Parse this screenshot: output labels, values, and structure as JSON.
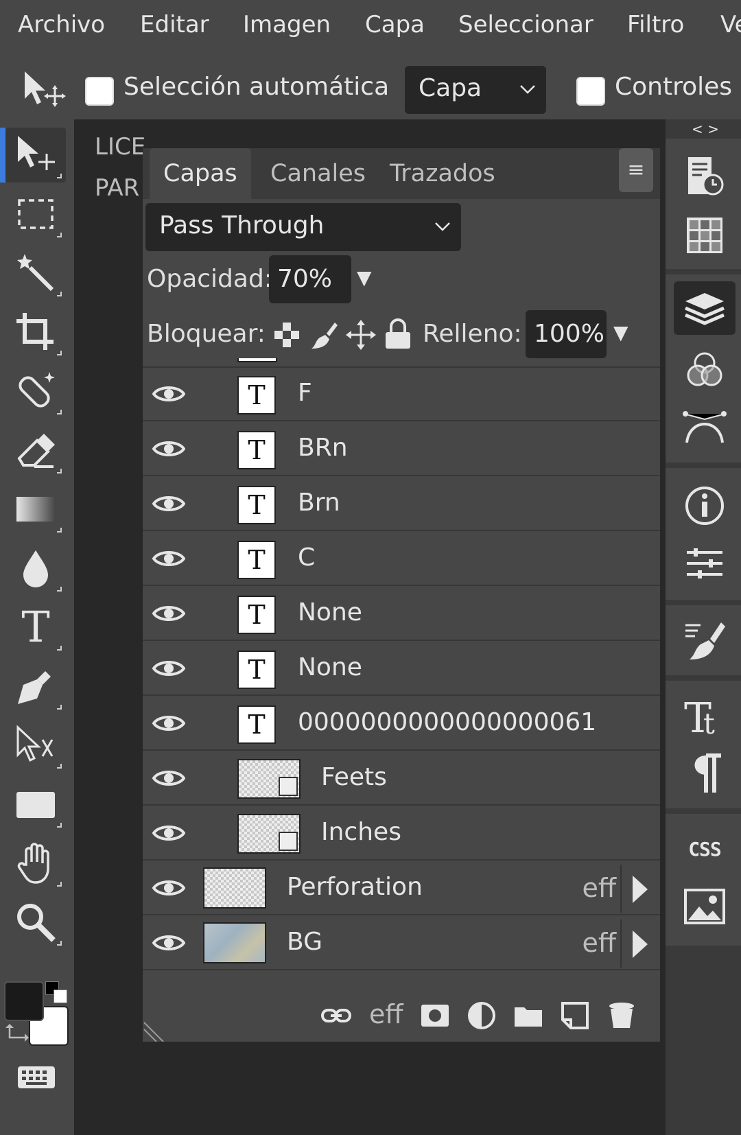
{
  "menubar": {
    "items": [
      "Archivo",
      "Editar",
      "Imagen",
      "Capa",
      "Seleccionar",
      "Filtro",
      "Ve"
    ]
  },
  "options": {
    "auto_select_label": "Selección automática",
    "auto_select_target": "Capa",
    "transform_controls_label": "Controles d"
  },
  "workspace": {
    "doc_tab_1": "LICE",
    "doc_tab_2": "PAR"
  },
  "layers_panel": {
    "tabs": [
      "Capas",
      "Canales",
      "Trazados"
    ],
    "menu_glyph": "≡",
    "blend_mode": "Pass Through",
    "opacity_label": "Opacidad:",
    "opacity_value": "70%",
    "lock_label": "Bloquear:",
    "fill_label": "Relleno:",
    "fill_value": "100%",
    "layers": [
      {
        "name": "F",
        "kind": "text",
        "glyph": "T"
      },
      {
        "name": "BRn",
        "kind": "text",
        "glyph": "T"
      },
      {
        "name": "Brn",
        "kind": "text",
        "glyph": "T"
      },
      {
        "name": "C",
        "kind": "text",
        "glyph": "T"
      },
      {
        "name": "None",
        "kind": "text",
        "glyph": "T"
      },
      {
        "name": "None",
        "kind": "text",
        "glyph": "T"
      },
      {
        "name": "0000000000000000061",
        "kind": "text",
        "glyph": "T"
      },
      {
        "name": "Feets",
        "kind": "mask"
      },
      {
        "name": "Inches",
        "kind": "mask"
      },
      {
        "name": "Perforation",
        "kind": "raster",
        "effects": "eff"
      },
      {
        "name": "BG",
        "kind": "image",
        "effects": "eff"
      }
    ],
    "footer_eff": "eff"
  },
  "dock": {
    "collapse_glyph": "< >",
    "css_label": "CSS"
  },
  "colors": {
    "foreground": "#1a1a1a",
    "background": "#ffffff",
    "accent": "#3d7bdc"
  }
}
